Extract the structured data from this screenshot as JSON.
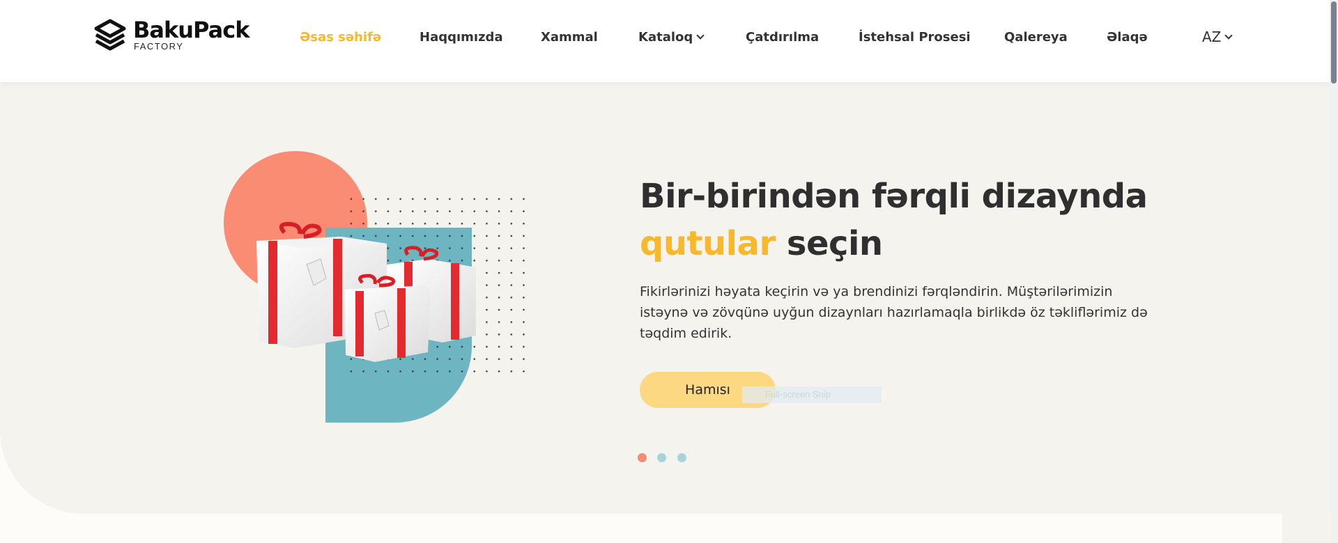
{
  "brand": {
    "name": "BakuPack",
    "subtitle": "FACTORY"
  },
  "nav": {
    "items": [
      {
        "label": "Əsas səhifə",
        "active": true
      },
      {
        "label": "Haqqımızda"
      },
      {
        "label": "Xammal"
      },
      {
        "label": "Kataloq",
        "has_dropdown": true
      },
      {
        "label": "Çatdırılma"
      },
      {
        "label": "İstehsal Prosesi"
      },
      {
        "label": "Qalereya"
      },
      {
        "label": "Əlaqə"
      }
    ],
    "language": "AZ"
  },
  "hero": {
    "title_line1": "Bir-birindən fərqli dizaynda",
    "title_accent": "qutular",
    "title_rest": "seçin",
    "description": "Fikirlərinizi həyata keçirin və ya brendinizi fərqləndirin. Müştərilərimizin istəynə və zövqünə uyğun dizaynları hazırlamaqla birlikdə öz təkliflərimiz də təqdim edirik.",
    "button_label": "Hamısı",
    "overlay_text": "Full-screen Snip"
  },
  "slider": {
    "count": 3,
    "active_index": 0,
    "colors": {
      "active": "#f48b74",
      "inactive": "#a9d3da"
    }
  },
  "colors": {
    "accent": "#f7b82b",
    "coral": "#fb8c74",
    "teal": "#6db5c1",
    "button": "#fcd883",
    "background": "#f4f3ee"
  },
  "icons": [
    "bakupack-logo-icon",
    "chevron-down-icon",
    "gift-boxes-image"
  ]
}
